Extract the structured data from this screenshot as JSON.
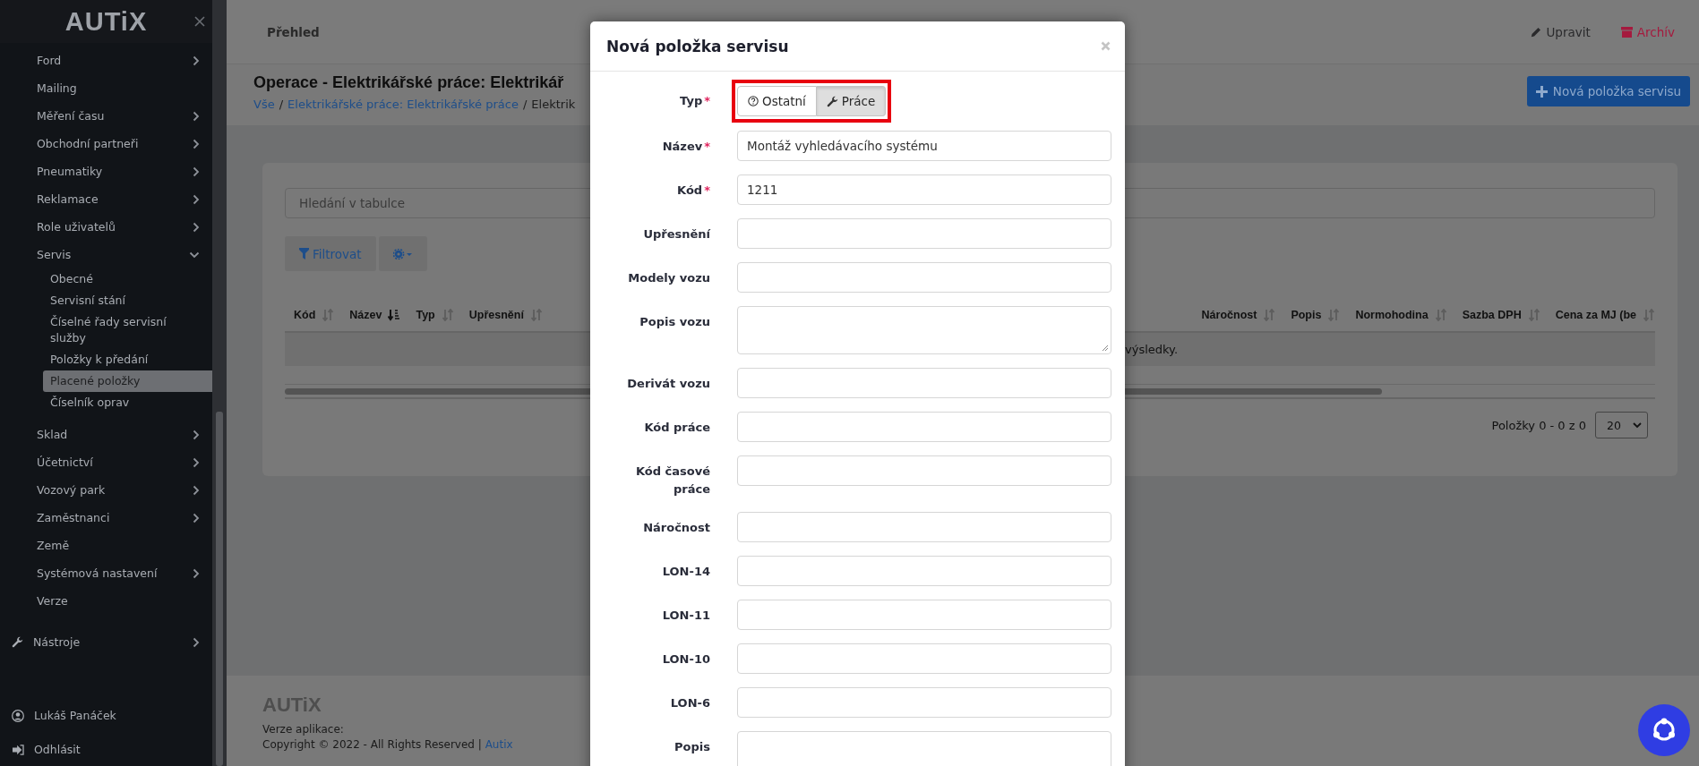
{
  "sidebar": {
    "logo": "AUTiX",
    "items": [
      {
        "kind": "group",
        "label": "Ford",
        "expanded": false
      },
      {
        "kind": "link",
        "label": "Mailing"
      },
      {
        "kind": "group",
        "label": "Měření času",
        "expanded": false
      },
      {
        "kind": "group",
        "label": "Obchodní partneři",
        "expanded": false
      },
      {
        "kind": "group",
        "label": "Pneumatiky",
        "expanded": false
      },
      {
        "kind": "group",
        "label": "Reklamace",
        "expanded": false
      },
      {
        "kind": "group",
        "label": "Role uživatelů",
        "expanded": false
      },
      {
        "kind": "group",
        "label": "Servis",
        "expanded": true,
        "children": [
          {
            "label": "Obecné",
            "selected": false
          },
          {
            "label": "Servisní stání",
            "selected": false
          },
          {
            "label": "Číselné řady servisní služby",
            "selected": false
          },
          {
            "label": "Položky k předání",
            "selected": false
          },
          {
            "label": "Placené položky",
            "selected": true
          },
          {
            "label": "Číselník oprav",
            "selected": false
          }
        ]
      },
      {
        "kind": "group",
        "label": "Sklad",
        "expanded": false
      },
      {
        "kind": "group",
        "label": "Účetnictví",
        "expanded": false
      },
      {
        "kind": "group",
        "label": "Vozový park",
        "expanded": false
      },
      {
        "kind": "group",
        "label": "Zaměstnanci",
        "expanded": false
      },
      {
        "kind": "link",
        "label": "Země"
      },
      {
        "kind": "group",
        "label": "Systémová nastavení",
        "expanded": false
      },
      {
        "kind": "link",
        "label": "Verze"
      }
    ],
    "tools": {
      "label": "Nástroje",
      "expanded": false
    },
    "user": "Lukáš Panáček",
    "logout": "Odhlásit"
  },
  "topbar": {
    "nav": "Přehled",
    "actions": [
      {
        "kind": "edit",
        "label": "Upravit"
      },
      {
        "kind": "archive",
        "label": "Archív"
      }
    ]
  },
  "page": {
    "title": "Operace - Elektrikářské práce: Elektrikář",
    "breadcrumb": [
      {
        "label": "Vše",
        "link": true
      },
      {
        "label": "Elektrikářské práce: Elektrikářské práce",
        "link": true
      },
      {
        "label": "Elektrik",
        "link": false
      }
    ],
    "separator": "/",
    "new_button": "Nová položka servisu"
  },
  "table": {
    "search_placeholder": "Hledání v tabulce",
    "filter_button": "Filtrovat",
    "columns": [
      {
        "label": "Kód",
        "sorted": false
      },
      {
        "label": "Název",
        "sorted": true
      },
      {
        "label": "Typ",
        "sorted": false
      },
      {
        "label": "Upřesnění",
        "sorted": false
      },
      {
        "label": "Náročnost",
        "sorted": false
      },
      {
        "label": "Popis",
        "sorted": false
      },
      {
        "label": "Normohodina",
        "sorted": false
      },
      {
        "label": "Sazba DPH",
        "sorted": false
      },
      {
        "label": "Cena za MJ (be",
        "sorted": false
      }
    ],
    "empty_message": "výsledky.",
    "pagination": "Položky 0 - 0 z 0",
    "page_size": "20"
  },
  "footer": {
    "logo": "AUTiX",
    "version_label": "Verze aplikace:",
    "copyright": "Copyright © 2022 - All Rights Reserved | ",
    "link": "Autix"
  },
  "modal": {
    "title": "Nová položka servisu",
    "required_marker": "*",
    "fields": [
      {
        "kind": "toggle",
        "label": "Typ",
        "required": true,
        "highlighted": true,
        "options": [
          {
            "label": "Ostatní",
            "selected": false
          },
          {
            "label": "Práce",
            "selected": true
          }
        ]
      },
      {
        "kind": "input",
        "label": "Název",
        "required": true,
        "highlighted": false,
        "value": "Montáž vyhledávacího systému"
      },
      {
        "kind": "input",
        "label": "Kód",
        "required": true,
        "highlighted": false,
        "value": "1211"
      },
      {
        "kind": "input",
        "label": "Upřesnění",
        "required": false,
        "highlighted": false
      },
      {
        "kind": "input",
        "label": "Modely vozu",
        "required": false,
        "highlighted": false
      },
      {
        "kind": "textarea",
        "label": "Popis vozu",
        "required": false,
        "highlighted": false
      },
      {
        "kind": "input",
        "label": "Derivát vozu",
        "required": false,
        "highlighted": false
      },
      {
        "kind": "input",
        "label": "Kód práce",
        "required": false,
        "highlighted": false
      },
      {
        "kind": "input",
        "label": "Kód časové práce",
        "required": false,
        "highlighted": false
      },
      {
        "kind": "input",
        "label": "Náročnost",
        "required": false,
        "highlighted": false
      },
      {
        "kind": "input",
        "label": "LON-14",
        "required": false,
        "highlighted": false
      },
      {
        "kind": "input",
        "label": "LON-11",
        "required": false,
        "highlighted": false
      },
      {
        "kind": "input",
        "label": "LON-10",
        "required": false,
        "highlighted": false
      },
      {
        "kind": "input",
        "label": "LON-6",
        "required": false,
        "highlighted": false
      },
      {
        "kind": "textarea",
        "label": "Popis",
        "required": false,
        "highlighted": false
      }
    ]
  }
}
